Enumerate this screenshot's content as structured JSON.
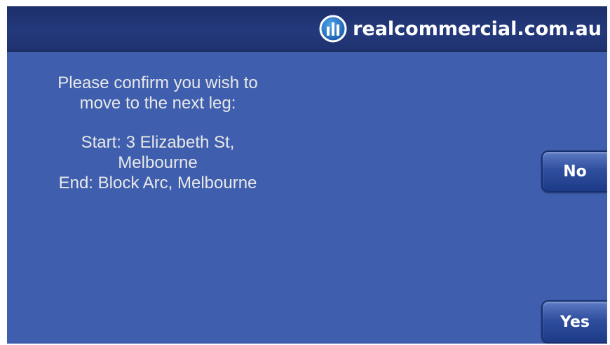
{
  "brand": {
    "name": "realcommercial.com.au",
    "logo_icon": "realcommercial-logo-icon"
  },
  "message": {
    "line1": "Please confirm you wish to",
    "line2": "move to the next leg:",
    "start_line1": "Start: 3 Elizabeth St,",
    "start_line2": "Melbourne",
    "end_line": "End: Block Arc, Melbourne"
  },
  "buttons": {
    "no_label": "No",
    "yes_label": "Yes"
  },
  "colors": {
    "background": "#3f5fae",
    "header": "#24397c",
    "button": "#2f4f9e",
    "text": "#e8e8e8"
  }
}
